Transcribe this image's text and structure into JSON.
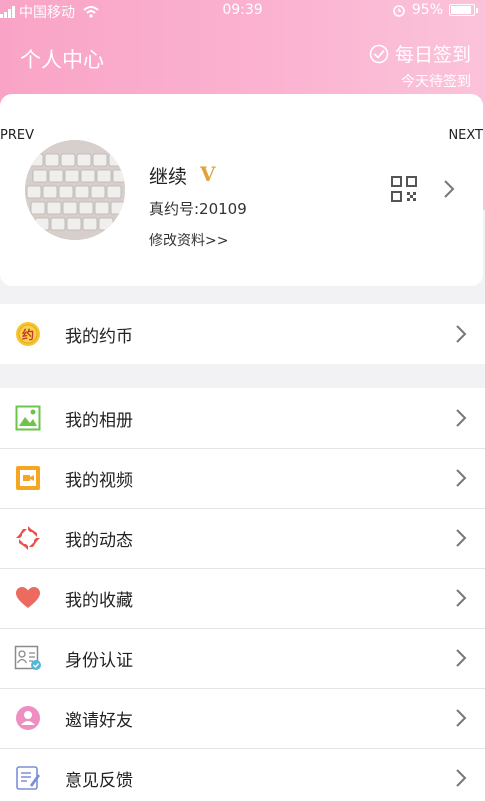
{
  "status_bar": {
    "carrier": "中国移动",
    "time": "09:39",
    "battery": "95%"
  },
  "header": {
    "title": "个人中心",
    "checkin_label": "每日签到",
    "checkin_sub": "今天待签到"
  },
  "profile": {
    "prev_label": "PREV",
    "next_label": "NEXT",
    "nickname": "继续",
    "vip_badge": "V",
    "uid": "真约号:20109",
    "edit_link": "修改资料>>"
  },
  "coins": {
    "icon_text": "约",
    "label": "我的约币"
  },
  "menu": {
    "items": [
      {
        "label": "我的相册",
        "icon": "photo-album-icon"
      },
      {
        "label": "我的视频",
        "icon": "video-icon"
      },
      {
        "label": "我的动态",
        "icon": "moments-icon"
      },
      {
        "label": "我的收藏",
        "icon": "heart-icon"
      },
      {
        "label": "身份认证",
        "icon": "id-card-icon"
      },
      {
        "label": "邀请好友",
        "icon": "invite-friend-icon"
      },
      {
        "label": "意见反馈",
        "icon": "feedback-icon"
      }
    ]
  },
  "colors": {
    "header_pink": "#f9a4c6",
    "vip_gold": "#e0a23a"
  }
}
